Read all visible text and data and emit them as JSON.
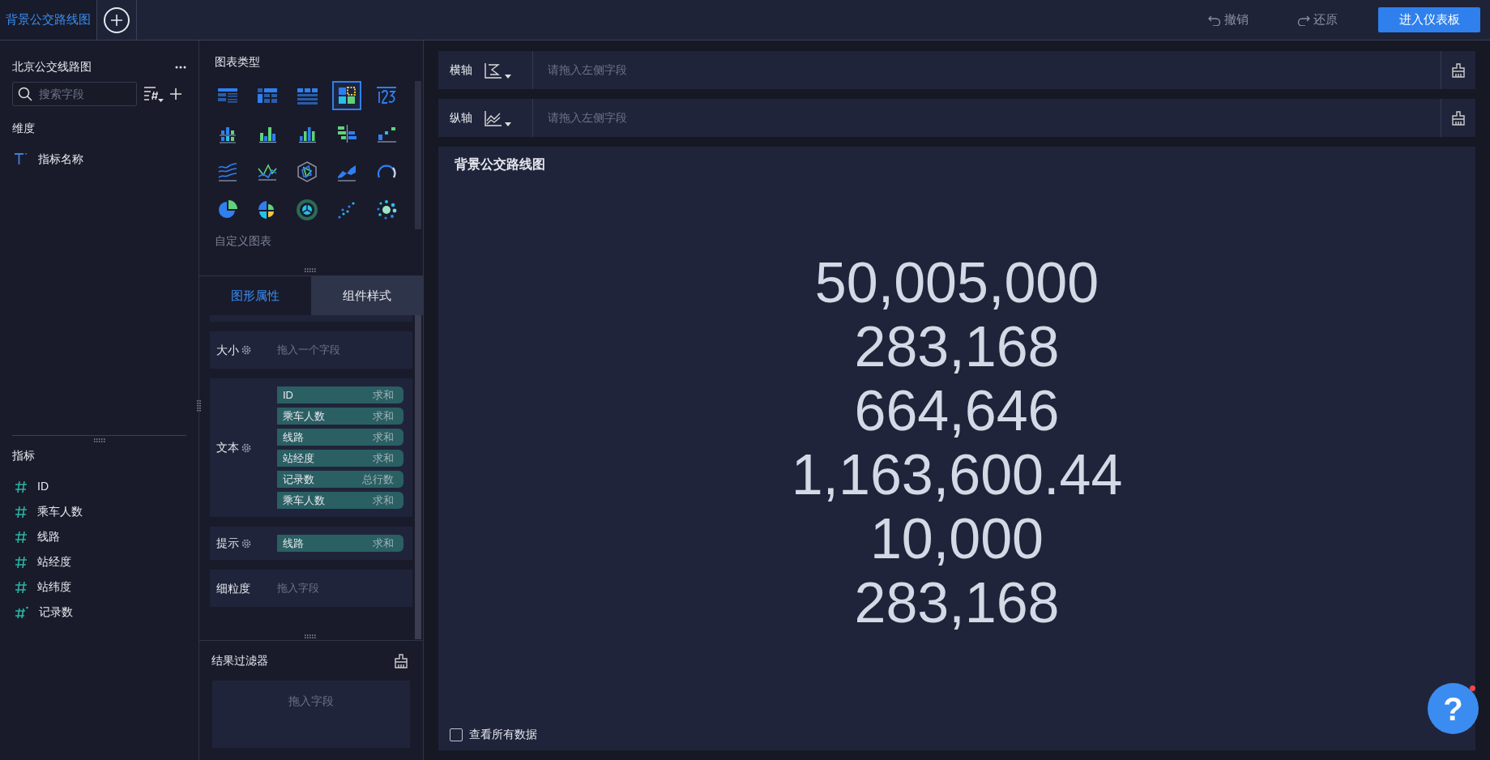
{
  "tabs": [
    {
      "label": "背景公交路线图",
      "selected": true
    }
  ],
  "toolbar": {
    "undo": "撤销",
    "redo": "还原",
    "primary_button": "进入仪表板"
  },
  "data_panel": {
    "title": "北京公交线路图",
    "search": {
      "placeholder": "搜索字段"
    },
    "dimensions": {
      "title": "维度",
      "items": [
        {
          "name": "指标名称",
          "kind": "text"
        }
      ]
    },
    "measures": {
      "title": "指标",
      "items": [
        {
          "name": "ID",
          "kind": "number"
        },
        {
          "name": "乘车人数",
          "kind": "number"
        },
        {
          "name": "线路",
          "kind": "number"
        },
        {
          "name": "站经度",
          "kind": "number"
        },
        {
          "name": "站纬度",
          "kind": "number"
        },
        {
          "name": "记录数",
          "kind": "computed"
        }
      ]
    }
  },
  "chart_panel": {
    "title": "图表类型",
    "custom": "自定义图表",
    "chart_types": [
      {
        "kind": "table",
        "selected": false
      },
      {
        "kind": "cross-table",
        "selected": false
      },
      {
        "kind": "detail-table",
        "selected": false
      },
      {
        "kind": "kpi",
        "selected": true
      },
      {
        "kind": "number",
        "selected": false
      },
      {
        "kind": "stacked-bar",
        "selected": false
      },
      {
        "kind": "grouped-bar",
        "selected": false
      },
      {
        "kind": "bar",
        "selected": false
      },
      {
        "kind": "horizontal-bar",
        "selected": false
      },
      {
        "kind": "step-bar",
        "selected": false
      },
      {
        "kind": "multi-line",
        "selected": false
      },
      {
        "kind": "line",
        "selected": false
      },
      {
        "kind": "radar",
        "selected": false
      },
      {
        "kind": "area",
        "selected": false
      },
      {
        "kind": "gauge",
        "selected": false
      },
      {
        "kind": "pie",
        "selected": false
      },
      {
        "kind": "rose",
        "selected": false
      },
      {
        "kind": "sunburst",
        "selected": false
      },
      {
        "kind": "scatter",
        "selected": false
      },
      {
        "kind": "bubble",
        "selected": false
      }
    ]
  },
  "property_tabs": [
    {
      "label": "图形属性",
      "selected": true
    },
    {
      "label": "组件样式",
      "selected": false
    }
  ],
  "properties": [
    {
      "label": "大小",
      "settings": true,
      "hint": "拖入一个字段"
    },
    {
      "label": "文本",
      "settings": true,
      "fields": [
        {
          "name": "ID",
          "aggregation": "求和"
        },
        {
          "name": "乘车人数",
          "aggregation": "求和"
        },
        {
          "name": "线路",
          "aggregation": "求和"
        },
        {
          "name": "站经度",
          "aggregation": "求和"
        },
        {
          "name": "记录数",
          "aggregation": "总行数"
        },
        {
          "name": "乘车人数",
          "aggregation": "求和"
        }
      ]
    },
    {
      "label": "提示",
      "settings": true,
      "fields": [
        {
          "name": "线路",
          "aggregation": "求和"
        }
      ]
    },
    {
      "label": "细粒度",
      "settings": false,
      "hint": "拖入字段"
    }
  ],
  "result_filter": {
    "title": "结果过滤器",
    "hint": "拖入字段"
  },
  "axes": [
    {
      "label": "横轴",
      "kind": "x",
      "hint": "请拖入左侧字段"
    },
    {
      "label": "纵轴",
      "kind": "y",
      "hint": "请拖入左侧字段"
    }
  ],
  "chart": {
    "title": "背景公交路线图",
    "values": [
      "50,005,000",
      "283,168",
      "664,646",
      "1,163,600.44",
      "10,000",
      "283,168"
    ]
  },
  "show_all_data": {
    "label": "查看所有数据",
    "checked": false
  },
  "help_button": {
    "label": "?"
  }
}
